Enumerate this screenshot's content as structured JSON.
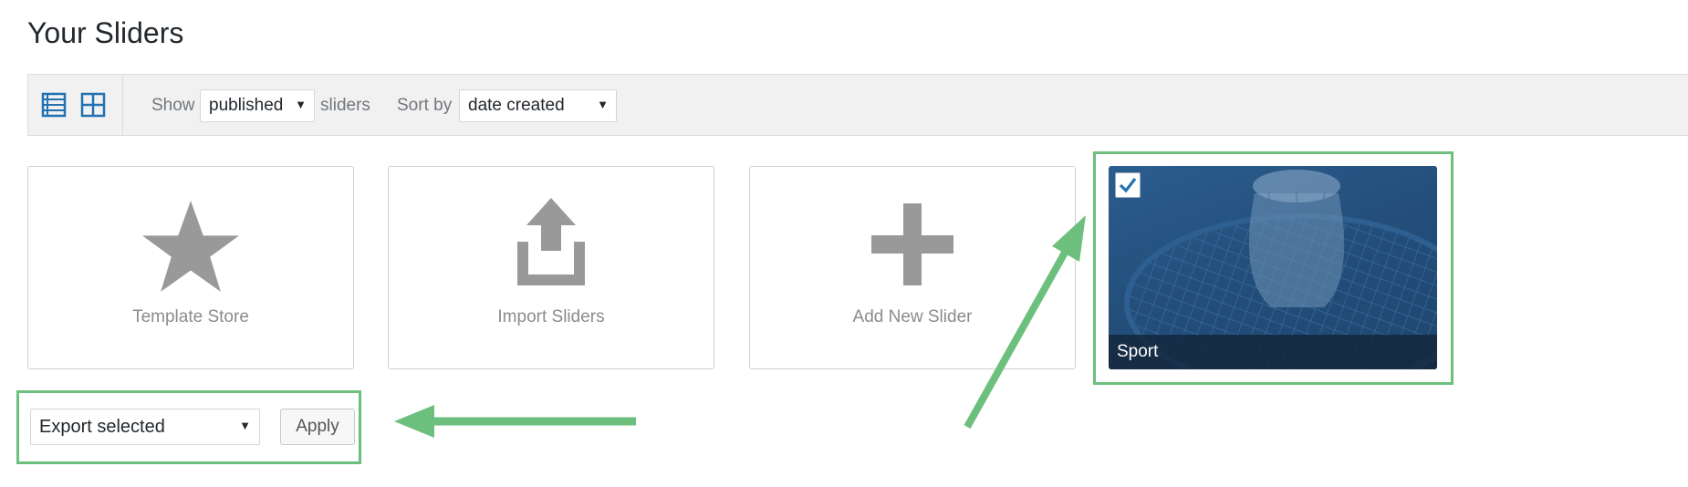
{
  "page": {
    "title": "Your Sliders"
  },
  "toolbar": {
    "list_view_icon": "list-view-icon",
    "grid_view_icon": "grid-view-icon",
    "show_label": "Show",
    "show_value": "published",
    "sliders_label": "sliders",
    "sort_label": "Sort by",
    "sort_value": "date created"
  },
  "cards": [
    {
      "label": "Template Store",
      "icon": "star-icon"
    },
    {
      "label": "Import Sliders",
      "icon": "upload-icon"
    },
    {
      "label": "Add New Slider",
      "icon": "plus-icon"
    }
  ],
  "sliders": [
    {
      "name": "Sport",
      "selected": true
    }
  ],
  "bulk": {
    "action_value": "Export selected",
    "apply_label": "Apply"
  },
  "colors": {
    "accent": "#2271b1",
    "highlight": "#6dbf7d",
    "icon_gray": "#999999",
    "slide_overlay": "#1e4670"
  }
}
